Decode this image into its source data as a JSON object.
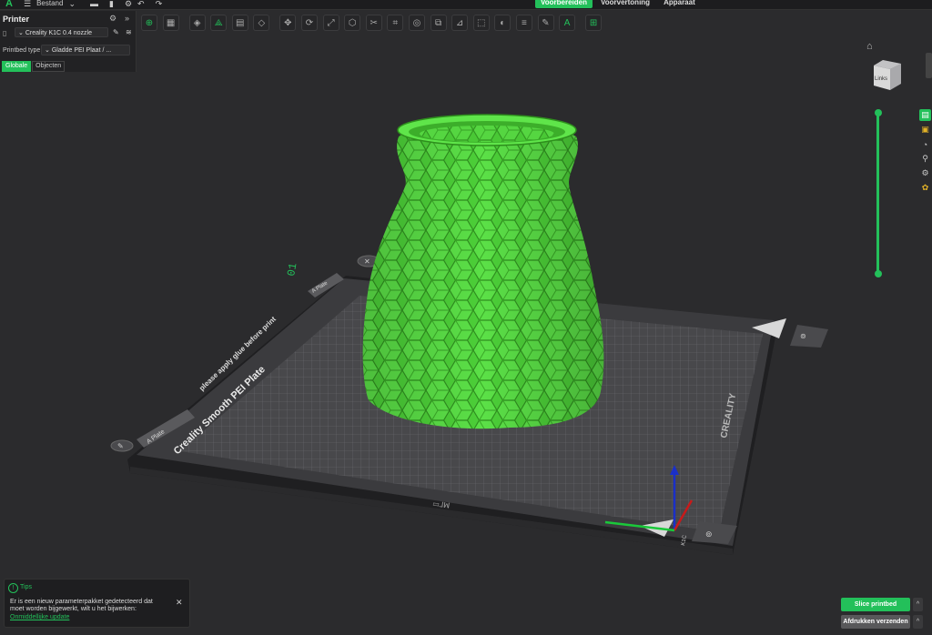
{
  "topbar": {
    "file_menu": "Bestand",
    "tabs": [
      "Voorbereiden",
      "Voorvertoning",
      "Apparaat"
    ],
    "active_tab": 0
  },
  "printer_panel": {
    "title": "Printer",
    "printer_name": "Creality K1C 0.4 nozzle",
    "bed_type_label": "Printbed type",
    "bed_type_value": "Gladde PEI Plaat / ...",
    "tabs": [
      "Globale",
      "Objecten"
    ],
    "active_tab": 0
  },
  "toolbar": {
    "items": [
      "add-icon",
      "grid-icon",
      "orient-icon",
      "auto-arrange-icon",
      "split-icon",
      "layer-icon",
      "move-icon",
      "rotate-icon",
      "scale-icon",
      "cube-icon",
      "cut-icon",
      "support-icon",
      "seam-icon",
      "boolean-icon",
      "measure-icon",
      "emboss-icon",
      "paint-icon",
      "text-icon",
      "assembly-icon",
      "plate-icon",
      "brim-icon",
      "fuzzy-icon"
    ]
  },
  "viewport": {
    "view_cube_label": "Links",
    "plate_label": "Creality Smooth PEI Plate",
    "plate_sub": "please apply glue before print",
    "plate_number": "01",
    "brand": "CREALITY",
    "plate_tab": "A Plate",
    "plate_tab_back": "A Plate"
  },
  "notification": {
    "title": "Tips",
    "text": "Er is een nieuw parameterpakket gedetecteerd dat moet worden bijgewerkt, wilt u het bijwerken:",
    "link": "Onmiddellijke update"
  },
  "actions": {
    "slice": "Slice printbed",
    "send": "Afdrukken verzenden"
  },
  "colors": {
    "accent": "#23c05a",
    "model": "#4fd23a",
    "bed": "#3a3a3c"
  }
}
